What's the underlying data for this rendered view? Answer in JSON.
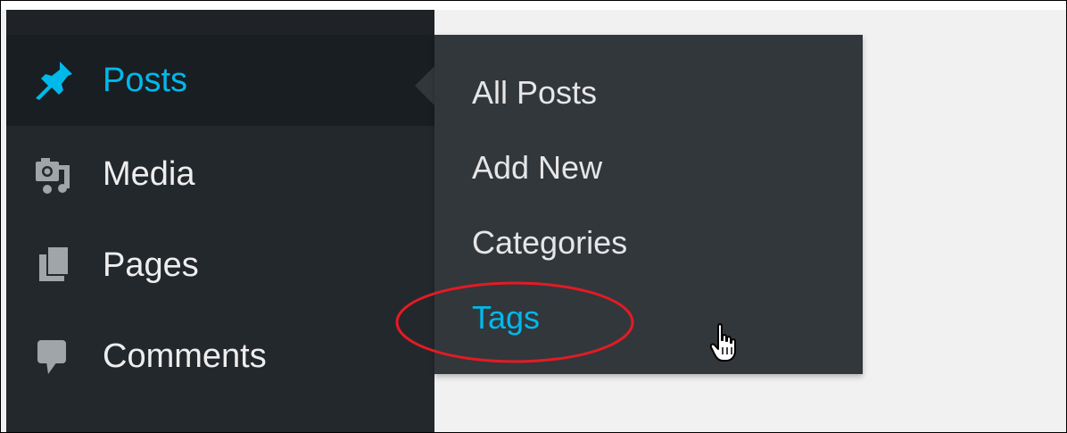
{
  "sidebar": {
    "items": [
      {
        "label": "Posts",
        "icon": "pin-icon",
        "active": true
      },
      {
        "label": "Media",
        "icon": "media-icon",
        "active": false
      },
      {
        "label": "Pages",
        "icon": "pages-icon",
        "active": false
      },
      {
        "label": "Comments",
        "icon": "comment-icon",
        "active": false
      }
    ]
  },
  "flyout": {
    "items": [
      {
        "label": "All Posts"
      },
      {
        "label": "Add New"
      },
      {
        "label": "Categories"
      },
      {
        "label": "Tags",
        "highlighted": true
      }
    ]
  },
  "colors": {
    "sidebar_bg": "#23282d",
    "active_bg": "#191e23",
    "flyout_bg": "#32373c",
    "accent": "#00b9eb",
    "annotation": "#e31b23",
    "content_bg": "#f1f1f1"
  },
  "cursor": {
    "icon": "hand-pointer-icon"
  }
}
